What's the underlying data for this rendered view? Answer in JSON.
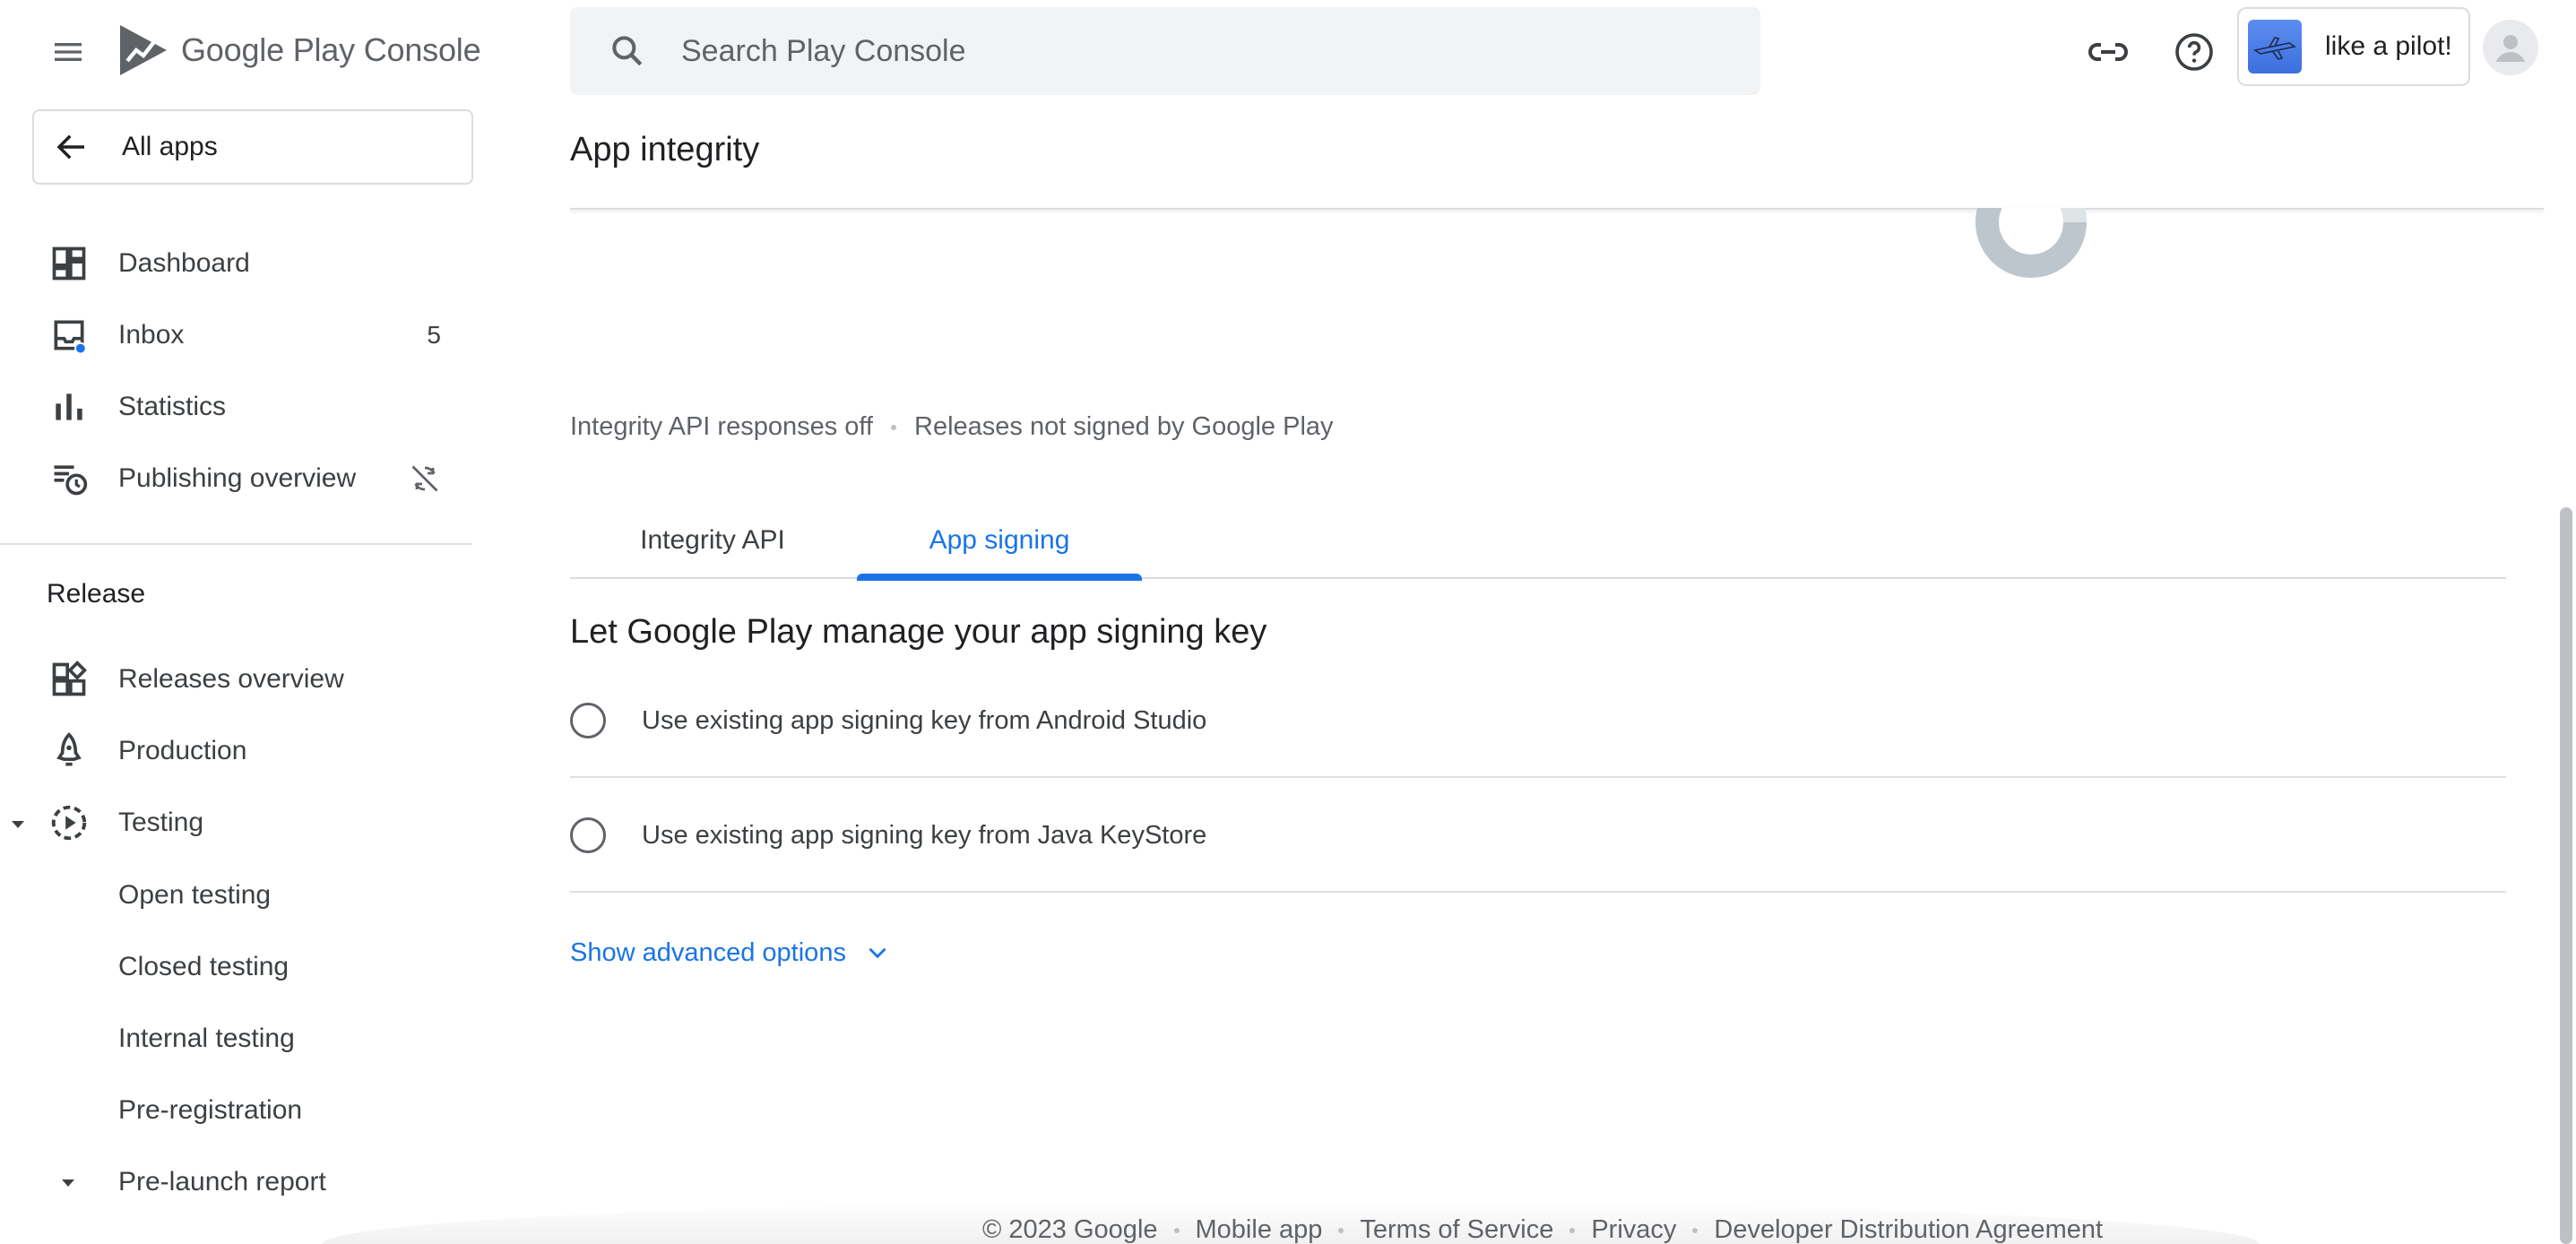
{
  "header": {
    "brand_google": "Google Play",
    "brand_console": "Console",
    "search_placeholder": "Search Play Console",
    "account_name": "like a pilot!"
  },
  "sidebar": {
    "all_apps": "All apps",
    "items": [
      {
        "label": "Dashboard",
        "icon": "dashboard-icon"
      },
      {
        "label": "Inbox",
        "icon": "inbox-icon",
        "badge": "5"
      },
      {
        "label": "Statistics",
        "icon": "bar-chart-icon"
      },
      {
        "label": "Publishing overview",
        "icon": "publishing-overview-icon",
        "trail_icon": "sync-disabled-icon"
      }
    ],
    "release_section": "Release",
    "release_items": [
      {
        "label": "Releases overview",
        "icon": "releases-overview-icon"
      },
      {
        "label": "Production",
        "icon": "production-icon"
      },
      {
        "label": "Testing",
        "icon": "testing-icon"
      }
    ],
    "testing_sub": [
      "Open testing",
      "Closed testing",
      "Internal testing",
      "Pre-registration"
    ],
    "pre_launch": "Pre-launch report"
  },
  "main": {
    "title": "App integrity",
    "status": [
      "Integrity API responses off",
      "Releases not signed by Google Play"
    ],
    "tabs": [
      {
        "label": "Integrity API",
        "active": false
      },
      {
        "label": "App signing",
        "active": true
      }
    ],
    "heading": "Let Google Play manage your app signing key",
    "options": [
      "Use existing app signing key from Android Studio",
      "Use existing app signing key from Java KeyStore"
    ],
    "advanced": "Show advanced options"
  },
  "footer": {
    "links": [
      "© 2023 Google",
      "Mobile app",
      "Terms of Service",
      "Privacy",
      "Developer Distribution Agreement"
    ]
  },
  "colors": {
    "accent": "#1a73e8",
    "text_primary": "#202124",
    "text_secondary": "#5f6368",
    "divider": "#dadce0"
  }
}
